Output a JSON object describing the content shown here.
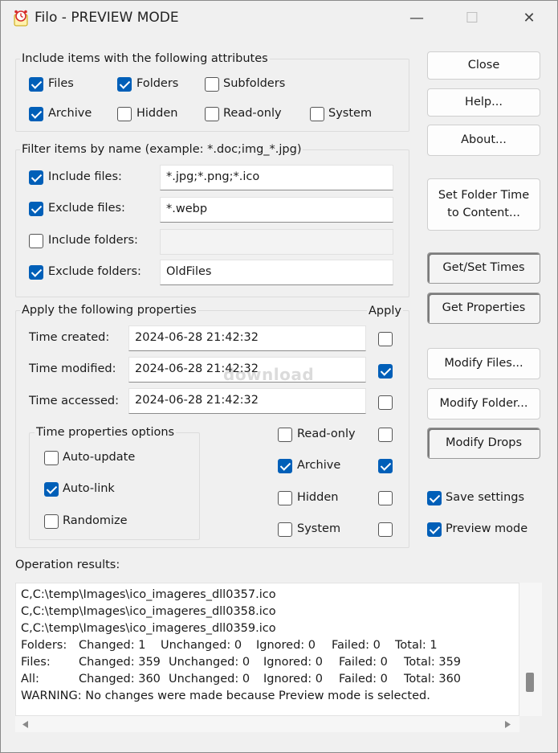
{
  "window": {
    "title": "Filo - PREVIEW MODE",
    "minimize": "—",
    "maximize": "☐",
    "close": "✕"
  },
  "attributes": {
    "legend": "Include items with the following attributes",
    "items": [
      {
        "label": "Files",
        "checked": true
      },
      {
        "label": "Folders",
        "checked": true
      },
      {
        "label": "Subfolders",
        "checked": false
      },
      {
        "label": "Archive",
        "checked": true
      },
      {
        "label": "Hidden",
        "checked": false
      },
      {
        "label": "Read-only",
        "checked": false
      },
      {
        "label": "System",
        "checked": false
      }
    ]
  },
  "filter": {
    "legend": "Filter items by name (example: *.doc;img_*.jpg)",
    "rows": [
      {
        "label": "Include files:",
        "checked": true,
        "value": "*.jpg;*.png;*.ico"
      },
      {
        "label": "Exclude files:",
        "checked": true,
        "value": "*.webp"
      },
      {
        "label": "Include folders:",
        "checked": false,
        "value": ""
      },
      {
        "label": "Exclude folders:",
        "checked": true,
        "value": "OldFiles"
      }
    ]
  },
  "properties": {
    "legend": "Apply the following properties",
    "apply_header": "Apply",
    "times": [
      {
        "label": "Time created:",
        "value": "2024-06-28 21:42:32",
        "apply": false
      },
      {
        "label": "Time modified:",
        "value": "2024-06-28 21:42:32",
        "apply": true
      },
      {
        "label": "Time accessed:",
        "value": "2024-06-28 21:42:32",
        "apply": false
      }
    ],
    "time_options": {
      "legend": "Time properties options",
      "items": [
        {
          "label": "Auto-update",
          "checked": false
        },
        {
          "label": "Auto-link",
          "checked": true
        },
        {
          "label": "Randomize",
          "checked": false
        }
      ]
    },
    "attrs": [
      {
        "label": "Read-only",
        "checked": false,
        "apply": false
      },
      {
        "label": "Archive",
        "checked": true,
        "apply": true
      },
      {
        "label": "Hidden",
        "checked": false,
        "apply": false
      },
      {
        "label": "System",
        "checked": false,
        "apply": false
      }
    ]
  },
  "buttons": {
    "close": "Close",
    "help": "Help...",
    "about": "About...",
    "set_folder_time_line1": "Set Folder Time",
    "set_folder_time_line2": "to Content...",
    "get_set_times": "Get/Set Times",
    "get_properties": "Get Properties",
    "modify_files": "Modify Files...",
    "modify_folder": "Modify Folder...",
    "modify_drops": "Modify Drops"
  },
  "settings": {
    "save_settings": {
      "label": "Save settings",
      "checked": true
    },
    "preview_mode": {
      "label": "Preview mode",
      "checked": true
    }
  },
  "results": {
    "label": "Operation results:",
    "lines": [
      "C,C:\\temp\\Images\\ico_imageres_dll0357.ico",
      "C,C:\\temp\\Images\\ico_imageres_dll0358.ico",
      "C,C:\\temp\\Images\\ico_imageres_dll0359.ico"
    ],
    "summary": [
      {
        "kind": "Folders:",
        "changed": "Changed: 1",
        "unchanged": "Unchanged: 0",
        "ignored": "Ignored: 0",
        "failed": "Failed: 0",
        "total": "Total: 1"
      },
      {
        "kind": "Files:",
        "changed": "Changed: 359",
        "unchanged": "Unchanged: 0",
        "ignored": "Ignored: 0",
        "failed": "Failed: 0",
        "total": "Total: 359"
      },
      {
        "kind": "All:",
        "changed": "Changed: 360",
        "unchanged": "Unchanged: 0",
        "ignored": "Ignored: 0",
        "failed": "Failed: 0",
        "total": "Total: 360"
      }
    ],
    "warning": "WARNING: No changes were made because Preview mode is selected."
  },
  "watermark": "download",
  "accent_color": "#005fb8"
}
